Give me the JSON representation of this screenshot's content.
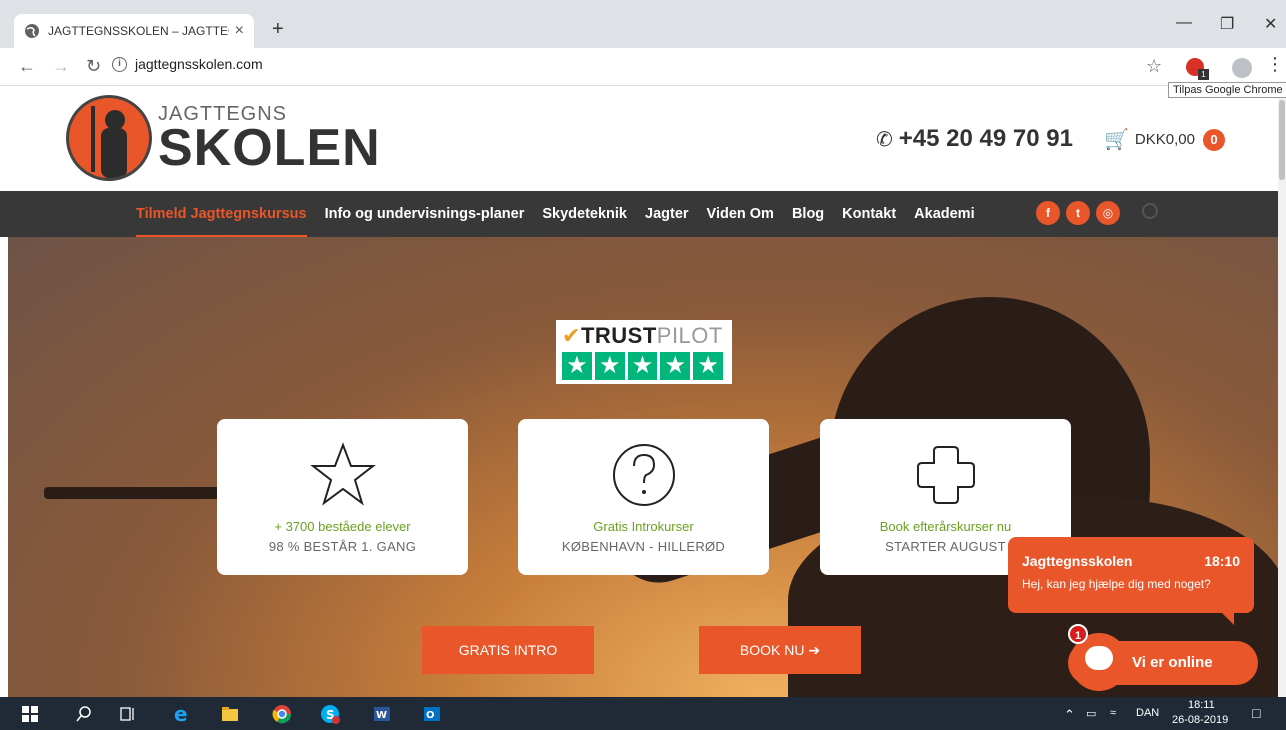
{
  "browser": {
    "tab_title": "JAGTTEGNSSKOLEN – JAGTTEGN",
    "tab_close": "×",
    "new_tab": "+",
    "url": "jagttegnsskolen.com",
    "info_glyph": "i",
    "tooltip": "Tilpas Google Chrome",
    "extension_badge": "1",
    "icons": [
      "globe-icon",
      "back-icon",
      "forward-icon",
      "reload-icon",
      "info-icon",
      "star-icon",
      "extension-icon",
      "profile-icon",
      "menu-icon"
    ]
  },
  "header": {
    "logo_small": "JAGTTEGNS",
    "logo_big": "SKOLEN",
    "phone": "+45 20 49 70 91",
    "cart_amount": "DKK0,00",
    "cart_count": "0",
    "accent_color": "#e8562a"
  },
  "nav": {
    "items": [
      {
        "label": "Tilmeld Jagttegnskursus",
        "active": true
      },
      {
        "label": "Info og undervisnings-planer",
        "active": false
      },
      {
        "label": "Skydeteknik",
        "active": false
      },
      {
        "label": "Jagter",
        "active": false
      },
      {
        "label": "Viden Om",
        "active": false
      },
      {
        "label": "Blog",
        "active": false
      },
      {
        "label": "Kontakt",
        "active": false
      },
      {
        "label": "Akademi",
        "active": false
      }
    ],
    "social": [
      "f",
      "t",
      "◎"
    ]
  },
  "hero": {
    "trustpilot": {
      "trust": "TRUST",
      "pilot": "PILOT",
      "stars": 5
    },
    "cards": [
      {
        "icon": "star-outline-icon",
        "line1": "+ 3700 beståede elever",
        "line2": "98 % BESTÅR 1. GANG"
      },
      {
        "icon": "question-circle-icon",
        "line1": "Gratis Introkurser",
        "line2": "KØBENHAVN - HILLERØD"
      },
      {
        "icon": "plus-outline-icon",
        "line1": "Book efterårskurser nu",
        "line2": "STARTER AUGUST"
      }
    ],
    "buttons": {
      "intro": "GRATIS INTRO",
      "book": "BOOK NU ➔"
    }
  },
  "chat": {
    "name": "Jagttegnsskolen",
    "time": "18:10",
    "message": "Hej, kan jeg hjælpe dig med noget?",
    "online_label": "Vi er online",
    "unread": "1"
  },
  "taskbar": {
    "lang": "DAN",
    "time": "18:11",
    "date": "26-08-2019"
  }
}
